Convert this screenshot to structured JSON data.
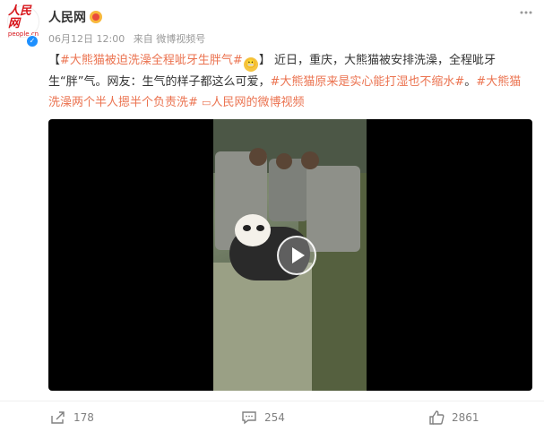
{
  "post": {
    "author": "人民网",
    "date": "06月12日 12:00",
    "source": "来自 微博视频号",
    "text": {
      "bracket_open": "【",
      "topic": "#大熊猫被迫洗澡全程呲牙生胖气#",
      "bracket_close": "】",
      "body": "近日，重庆，大熊猫被安排洗澡，全程呲牙生“胖”气。网友：生气的样子都这么可爱，",
      "tag2": "#大熊猫原来是实心能打湿也不缩水#",
      "punct": "。",
      "tag3": "#大熊猫洗澡两个半人摁半个负责洗#",
      "video_link": "人民网的微博视频"
    }
  },
  "avatar": {
    "logo_text": "人民网",
    "logo_sub": "people.cn"
  },
  "actions": {
    "share_count": "178",
    "comment_count": "254",
    "like_count": "2861"
  },
  "colors": {
    "topic": "#eb7350",
    "verified": "#1e90ff"
  }
}
